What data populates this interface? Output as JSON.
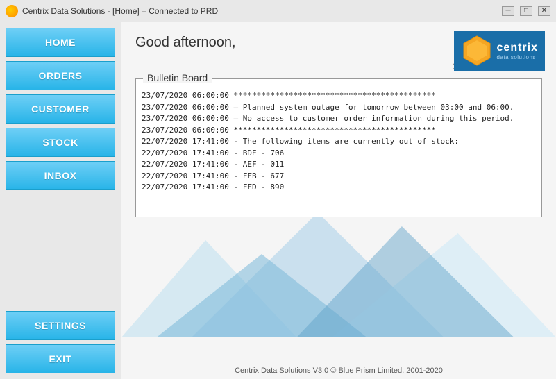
{
  "titleBar": {
    "title": "Centrix Data Solutions - [Home] – Connected to PRD",
    "minimize": "─",
    "maximize": "□",
    "close": "✕"
  },
  "sidebar": {
    "navItems": [
      {
        "id": "home",
        "label": "HOME"
      },
      {
        "id": "orders",
        "label": "ORDERS"
      },
      {
        "id": "customer",
        "label": "CUSTOMER"
      },
      {
        "id": "stock",
        "label": "STOCK"
      },
      {
        "id": "inbox",
        "label": "INBOX"
      }
    ],
    "bottomItems": [
      {
        "id": "settings",
        "label": "SETTINGS"
      },
      {
        "id": "exit",
        "label": "EXIT"
      }
    ]
  },
  "header": {
    "greeting": "Good afternoon,",
    "datetime": "24/07/2020 08:20:33"
  },
  "logo": {
    "name": "centrix",
    "subtitle": "data solutions"
  },
  "bulletin": {
    "title": "Bulletin Board",
    "lines": [
      "23/07/2020 06:00:00 ********************************************",
      "23/07/2020 06:00:00 – Planned system outage for tomorrow between 03:00 and 06:00.",
      "23/07/2020 06:00:00 – No access to customer order information during this period.",
      "23/07/2020 06:00:00 ********************************************",
      "",
      "22/07/2020 17:41:00 - The following items are currently out of stock:",
      "22/07/2020 17:41:00 - BDE - 706",
      "22/07/2020 17:41:00 - AEF - 011",
      "22/07/2020 17:41:00 - FFB - 677",
      "22/07/2020 17:41:00 - FFD - 890"
    ]
  },
  "footer": {
    "text": "Centrix Data Solutions V3.0 © Blue Prism Limited, 2001-2020"
  }
}
